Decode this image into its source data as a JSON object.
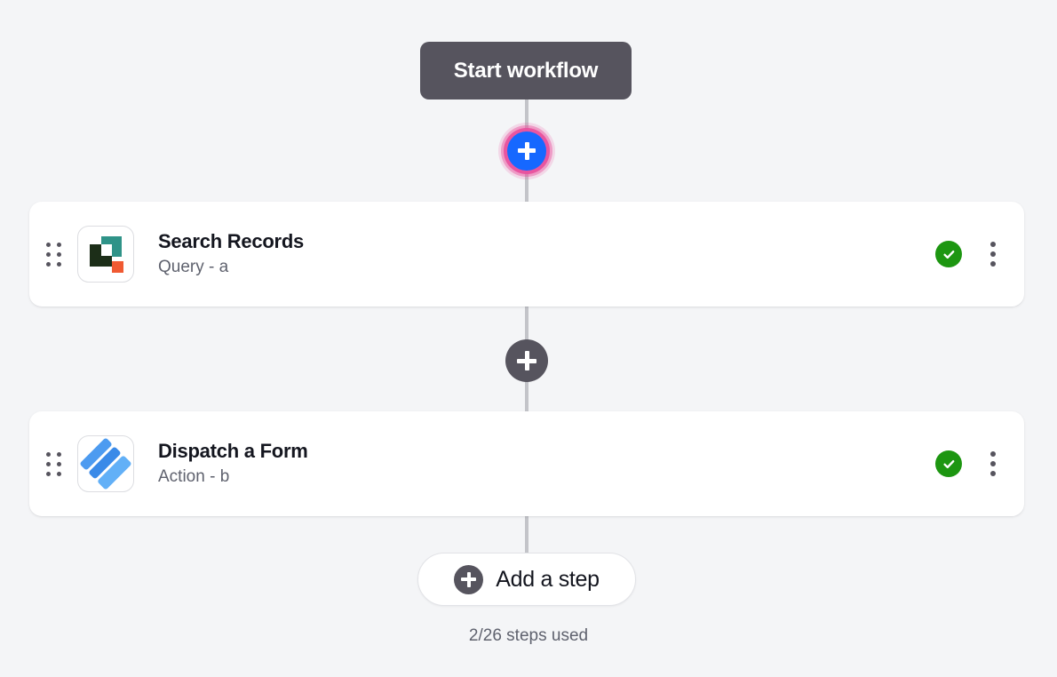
{
  "canvas": {
    "background_color": "#f4f5f7",
    "connector_color": "#c3c4c9"
  },
  "start": {
    "label": "Start workflow",
    "background_color": "#56545e",
    "text_color": "#ffffff"
  },
  "connectors": [
    {
      "name": "insert-step-top",
      "icon": "plus-icon",
      "state": "highlighted",
      "fill_color": "#1668ff",
      "ring_color": "#e8519e"
    },
    {
      "name": "insert-step-middle",
      "icon": "plus-icon",
      "state": "default",
      "fill_color": "#56545e"
    }
  ],
  "steps": [
    {
      "title": "Search Records",
      "subtitle": "Query - a",
      "icon": "airtable-query-icon",
      "icon_colors": {
        "teal": "#2f9388",
        "dark_green": "#1c2e18",
        "orange": "#f05a32"
      },
      "status": "valid",
      "status_icon": "check-circle-icon",
      "status_color": "#1d9611",
      "drag_handle_icon": "drag-handle-icon",
      "menu_icon": "kebab-menu-icon"
    },
    {
      "title": "Dispatch a Form",
      "subtitle": "Action - b",
      "icon": "jotform-action-icon",
      "icon_colors": {
        "blue_light": "#62b0f7",
        "blue_mid": "#4d9bf0",
        "blue_dark": "#3a8ae8"
      },
      "status": "valid",
      "status_icon": "check-circle-icon",
      "status_color": "#1d9611",
      "drag_handle_icon": "drag-handle-icon",
      "menu_icon": "kebab-menu-icon"
    }
  ],
  "add_step": {
    "label": "Add a step",
    "icon": "plus-circle-icon"
  },
  "footer": {
    "steps_used": "2/26 steps used"
  }
}
